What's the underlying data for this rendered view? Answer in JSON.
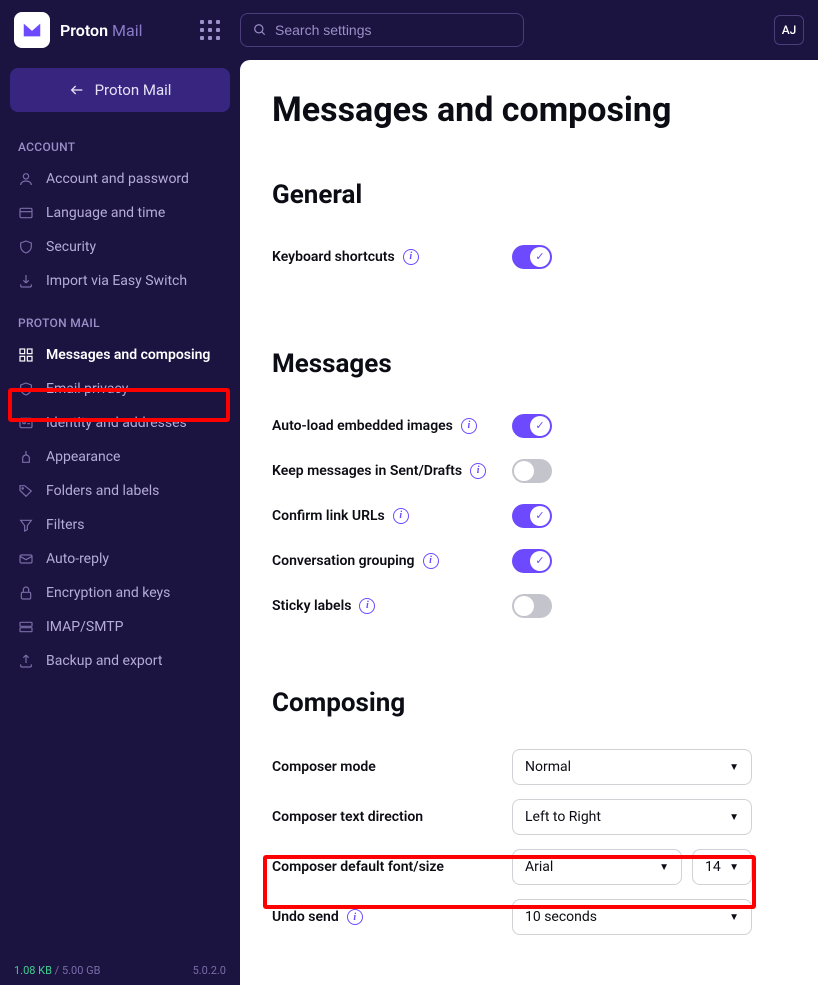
{
  "logo": {
    "brand": "Proton",
    "product": "Mail"
  },
  "search": {
    "placeholder": "Search settings"
  },
  "avatar": "AJ",
  "back_button": "Proton Mail",
  "sections": {
    "account": {
      "label": "ACCOUNT",
      "items": [
        {
          "label": "Account and password"
        },
        {
          "label": "Language and time"
        },
        {
          "label": "Security"
        },
        {
          "label": "Import via Easy Switch"
        }
      ]
    },
    "mail": {
      "label": "PROTON MAIL",
      "items": [
        {
          "label": "Messages and composing"
        },
        {
          "label": "Email privacy"
        },
        {
          "label": "Identity and addresses"
        },
        {
          "label": "Appearance"
        },
        {
          "label": "Folders and labels"
        },
        {
          "label": "Filters"
        },
        {
          "label": "Auto-reply"
        },
        {
          "label": "Encryption and keys"
        },
        {
          "label": "IMAP/SMTP"
        },
        {
          "label": "Backup and export"
        }
      ]
    }
  },
  "page": {
    "title": "Messages and composing",
    "general": {
      "heading": "General",
      "keyboard_shortcuts": "Keyboard shortcuts"
    },
    "messages": {
      "heading": "Messages",
      "auto_load": "Auto-load embedded images",
      "keep_sent": "Keep messages in Sent/Drafts",
      "confirm_links": "Confirm link URLs",
      "conversation": "Conversation grouping",
      "sticky": "Sticky labels"
    },
    "composing": {
      "heading": "Composing",
      "composer_mode": {
        "label": "Composer mode",
        "value": "Normal"
      },
      "text_direction": {
        "label": "Composer text direction",
        "value": "Left to Right"
      },
      "font": {
        "label": "Composer default font/size",
        "font": "Arial",
        "size": "14"
      },
      "undo": {
        "label": "Undo send",
        "value": "10 seconds"
      }
    }
  },
  "footer": {
    "used": "1.08 KB",
    "sep": " / ",
    "total": "5.00 GB",
    "version": "5.0.2.0"
  }
}
